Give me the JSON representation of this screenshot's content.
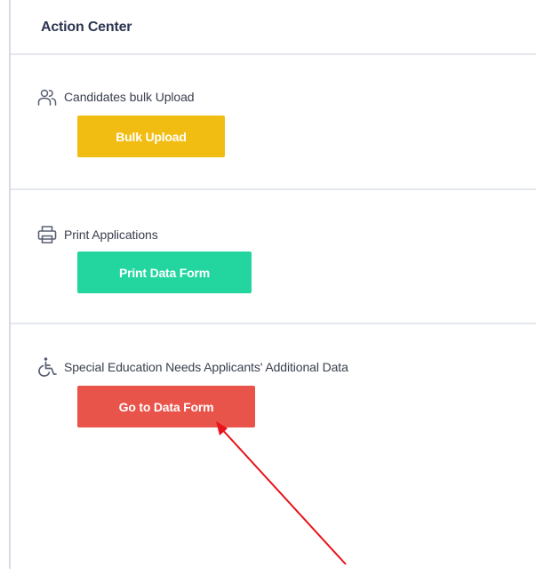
{
  "panel": {
    "title": "Action Center"
  },
  "sections": [
    {
      "icon": "users-icon",
      "label": "Candidates bulk Upload",
      "button_label": "Bulk Upload",
      "button_color": "#f2bd12"
    },
    {
      "icon": "printer-icon",
      "label": "Print Applications",
      "button_label": "Print Data Form",
      "button_color": "#23d69f"
    },
    {
      "icon": "wheelchair-icon",
      "label": "Special Education Needs Applicants' Additional Data",
      "button_label": "Go to Data Form",
      "button_color": "#e8534a"
    }
  ],
  "annotation": {
    "type": "arrow",
    "color": "#e8141b"
  }
}
